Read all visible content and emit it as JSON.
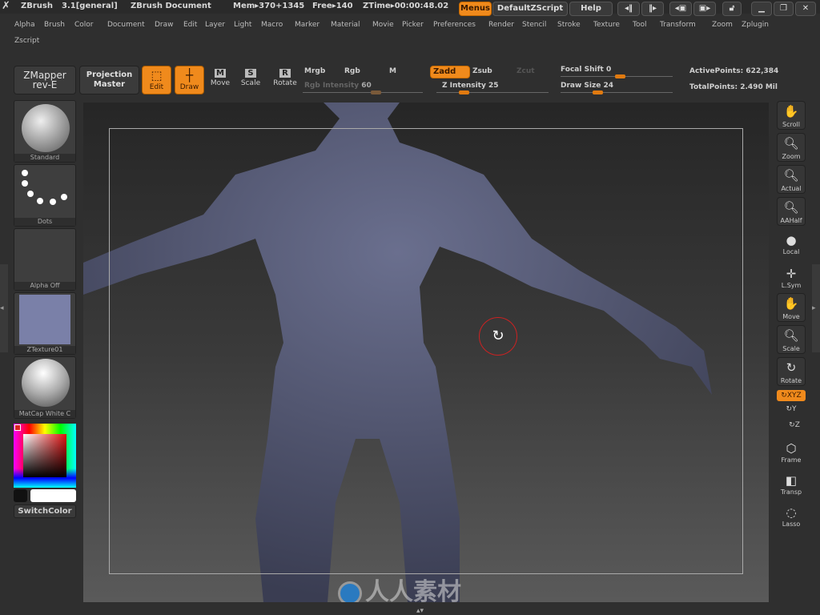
{
  "titlebar": {
    "app": "ZBrush",
    "version": "3.1[general]",
    "document": "ZBrush Document",
    "mem": "Mem▸370+1345",
    "free": "Free▸140",
    "ztime": "ZTime▸00:00:48.02",
    "menus": "Menus",
    "defaultzscript": "DefaultZScript",
    "help": "Help"
  },
  "menu": [
    "Alpha",
    "Brush",
    "Color",
    "Document",
    "Draw",
    "Edit",
    "Layer",
    "Light",
    "Macro",
    "Marker",
    "Material",
    "Movie",
    "Picker",
    "Preferences",
    "Render",
    "Stencil",
    "Stroke",
    "Texture",
    "Tool",
    "Transform",
    "Zoom",
    "Zplugin"
  ],
  "menu2": [
    "Zscript"
  ],
  "toolbar": {
    "zmapper": [
      "ZMapper",
      "rev-E"
    ],
    "projection": [
      "Projection",
      "Master"
    ],
    "edit": "Edit",
    "draw": "Draw",
    "move": "Move",
    "scale": "Scale",
    "rotate": "Rotate",
    "mrgb": "Mrgb",
    "rgb": "Rgb",
    "m": "M",
    "rgb_intensity_label": "Rgb Intensity",
    "rgb_intensity": 60,
    "zadd": "Zadd",
    "zsub": "Zsub",
    "zcut": "Zcut",
    "z_intensity_label": "Z Intensity",
    "z_intensity": 25,
    "focal_shift_label": "Focal Shift",
    "focal_shift": 0,
    "draw_size_label": "Draw Size",
    "draw_size": 24,
    "active_points": "ActivePoints: 622,384",
    "total_points": "TotalPoints: 2.490 Mil"
  },
  "left": {
    "brush": "Standard",
    "stroke": "Dots",
    "alpha": "Alpha Off",
    "texture": "ZTexture01",
    "material": "MatCap White C",
    "switchcolor": "SwitchColor",
    "primary_color": "#ff2020",
    "secondary_color": "#ffffff"
  },
  "right": [
    {
      "label": "Scroll",
      "icon": "hand-icon"
    },
    {
      "label": "Zoom",
      "icon": "magnifier-icon"
    },
    {
      "label": "Actual",
      "icon": "magnifier-icon"
    },
    {
      "label": "AAHalf",
      "icon": "magnifier-icon"
    },
    {
      "label": "Local",
      "icon": "local-icon"
    },
    {
      "label": "L.Sym",
      "icon": "symmetry-icon"
    },
    {
      "label": "Move",
      "icon": "hand-icon"
    },
    {
      "label": "Scale",
      "icon": "magnifier-icon"
    },
    {
      "label": "Rotate",
      "icon": "rotate-icon"
    },
    {
      "label": "XYZ",
      "icon": "rotate-xyz-icon"
    },
    {
      "label": "Y",
      "icon": "rotate-y-icon"
    },
    {
      "label": "Z",
      "icon": "rotate-z-icon"
    },
    {
      "label": "Frame",
      "icon": "cube-icon"
    },
    {
      "label": "Transp",
      "icon": "transparency-icon"
    },
    {
      "label": "Lasso",
      "icon": "lasso-icon"
    }
  ],
  "watermark": "人人素材",
  "accent": "#f08a1c"
}
